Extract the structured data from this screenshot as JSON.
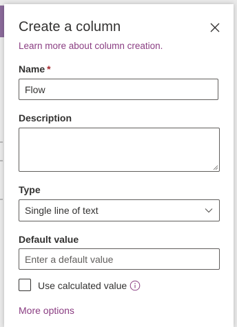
{
  "panel": {
    "title": "Create a column",
    "learn_more_link": "Learn more about column creation."
  },
  "fields": {
    "name": {
      "label": "Name",
      "required_marker": "*",
      "value": "Flow"
    },
    "description": {
      "label": "Description",
      "value": ""
    },
    "type": {
      "label": "Type",
      "selected": "Single line of text"
    },
    "default_value": {
      "label": "Default value",
      "value": "",
      "placeholder": "Enter a default value"
    },
    "use_calculated": {
      "label": "Use calculated value",
      "checked": false
    }
  },
  "more_options_link": "More options",
  "icons": {
    "close": "close-icon",
    "chevron": "chevron-down-icon",
    "info": "info-icon"
  },
  "colors": {
    "accent_link": "#8a3d82",
    "required": "#a4262c",
    "text": "#323130",
    "border": "#605e5c"
  }
}
